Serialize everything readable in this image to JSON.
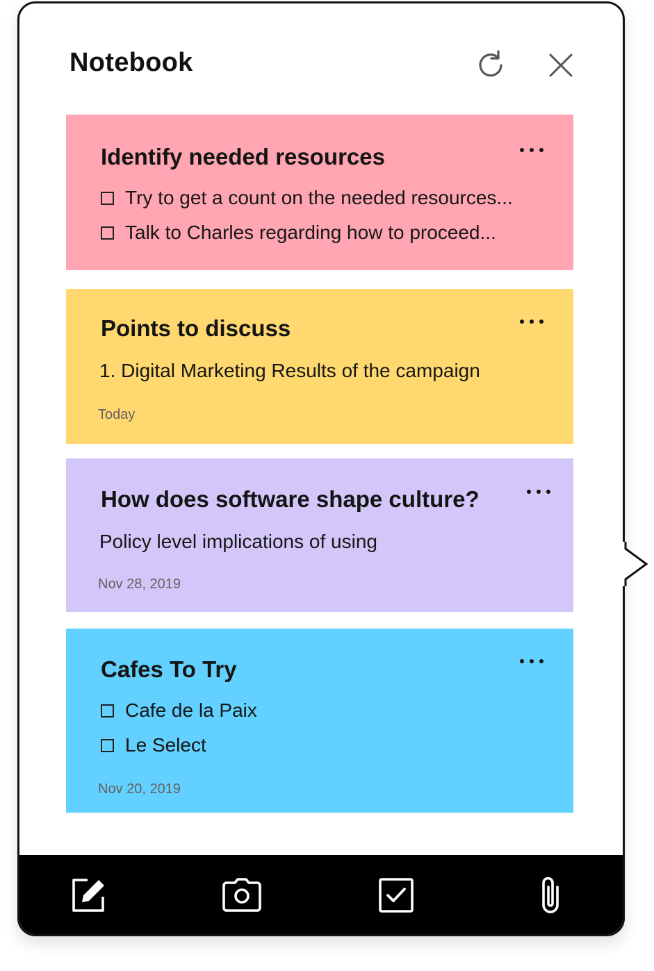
{
  "header": {
    "title": "Notebook",
    "refresh_icon": "refresh-icon",
    "close_icon": "close-icon"
  },
  "notes": [
    {
      "title": "Identify needed resources",
      "color": "#FFA6B2",
      "items": [
        "Try to get a count on the needed resources...",
        "Talk to Charles regarding how to proceed..."
      ]
    },
    {
      "title": "Points to discuss",
      "color": "#FFD970",
      "body": "1. Digital Marketing Results of the campaign",
      "date": "Today"
    },
    {
      "title": "How does software shape culture?",
      "color": "#D3C7FA",
      "body": "Policy level implications of using",
      "date": "Nov 28, 2019"
    },
    {
      "title": "Cafes To Try",
      "color": "#62D1FF",
      "items": [
        "Cafe de la Paix",
        "Le Select"
      ],
      "date": "Nov 20, 2019"
    }
  ],
  "toolbar": {
    "background": "#000000",
    "icons": [
      "edit-note-icon",
      "camera-icon",
      "checklist-icon",
      "attachment-icon"
    ]
  }
}
